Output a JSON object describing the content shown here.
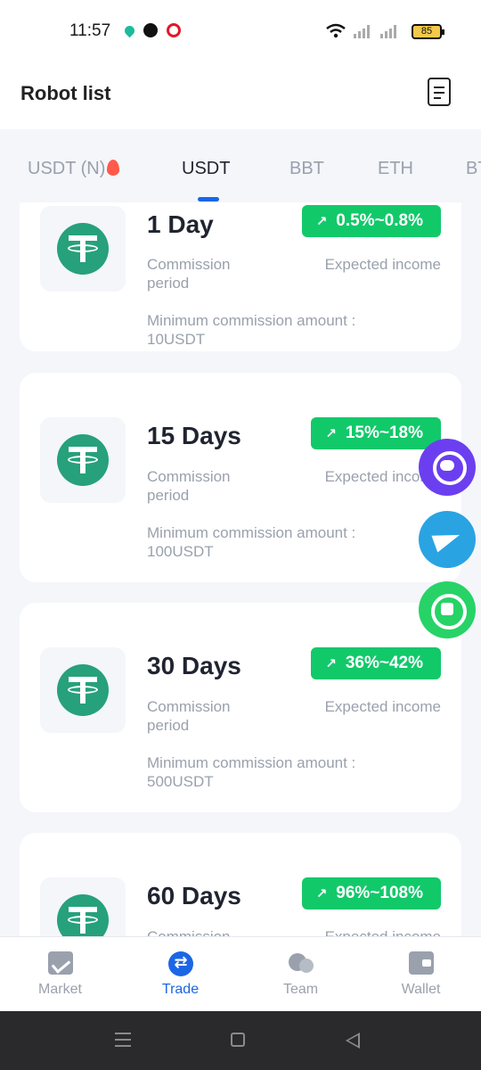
{
  "status_bar": {
    "time": "11:57",
    "battery": "85",
    "app_icons": [
      "drop-icon",
      "messenger-icon",
      "red-circle-icon"
    ]
  },
  "header": {
    "title": "Robot list",
    "action_icon": "document-icon"
  },
  "tabs": [
    {
      "label": "USDT (N)",
      "active": false,
      "icon": "flame-icon"
    },
    {
      "label": "USDT",
      "active": true
    },
    {
      "label": "BBT",
      "active": false
    },
    {
      "label": "ETH",
      "active": false
    },
    {
      "label": "BT",
      "active": false
    }
  ],
  "robots": [
    {
      "period": "1 Day",
      "income_range": "0.5%~0.8%",
      "period_label": "Commission period",
      "income_label": "Expected income",
      "minimum": "Minimum commission amount : 10USDT"
    },
    {
      "period": "15 Days",
      "income_range": "15%~18%",
      "period_label": "Commission period",
      "income_label": "Expected income",
      "minimum": "Minimum commission amount : 100USDT"
    },
    {
      "period": "30 Days",
      "income_range": "36%~42%",
      "period_label": "Commission period",
      "income_label": "Expected income",
      "minimum": "Minimum commission amount : 500USDT"
    },
    {
      "period": "60 Days",
      "income_range": "96%~108%",
      "period_label": "Commission period",
      "income_label": "Expected income",
      "minimum": ""
    }
  ],
  "badge_arrow": "↗",
  "floating_buttons": [
    "support-icon",
    "telegram-icon",
    "whatsapp-icon"
  ],
  "bottom_nav": [
    {
      "label": "Market",
      "icon": "market-chart-icon",
      "active": false
    },
    {
      "label": "Trade",
      "icon": "trade-exchange-icon",
      "active": true
    },
    {
      "label": "Team",
      "icon": "team-icon",
      "active": false
    },
    {
      "label": "Wallet",
      "icon": "wallet-icon",
      "active": false
    }
  ],
  "colors": {
    "accent": "#1c66e5",
    "badge_green": "#12c96a",
    "tether_green": "#26a17b",
    "support_purple": "#6b3ff0",
    "telegram_blue": "#2aa3e3",
    "whatsapp_green": "#27d366"
  }
}
